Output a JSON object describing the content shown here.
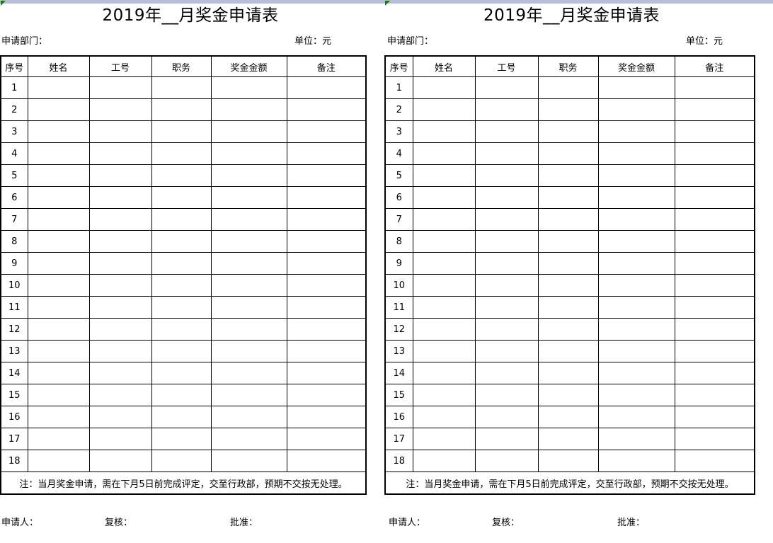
{
  "app": {
    "green_marker_icon": "comment-marker-icon"
  },
  "form": {
    "title": "2019年__月奖金申请表",
    "department_label": "申请部门：",
    "unit_label": "单位：元",
    "columns": [
      "序号",
      "姓名",
      "工号",
      "职务",
      "奖金金额",
      "备注"
    ],
    "rows": [
      "1",
      "2",
      "3",
      "4",
      "5",
      "6",
      "7",
      "8",
      "9",
      "10",
      "11",
      "12",
      "13",
      "14",
      "15",
      "16",
      "17",
      "18"
    ],
    "note": "注：当月奖金申请，需在下月5日前完成评定，交至行政部，预期不交按无处理。",
    "signatures": {
      "applicant": "申请人：",
      "reviewer": "复核：",
      "approver": "批准："
    }
  },
  "colors": {
    "top_strip": "#b8bcd4",
    "marker_green": "#1a7a16",
    "border": "#000000",
    "background": "#ffffff"
  }
}
